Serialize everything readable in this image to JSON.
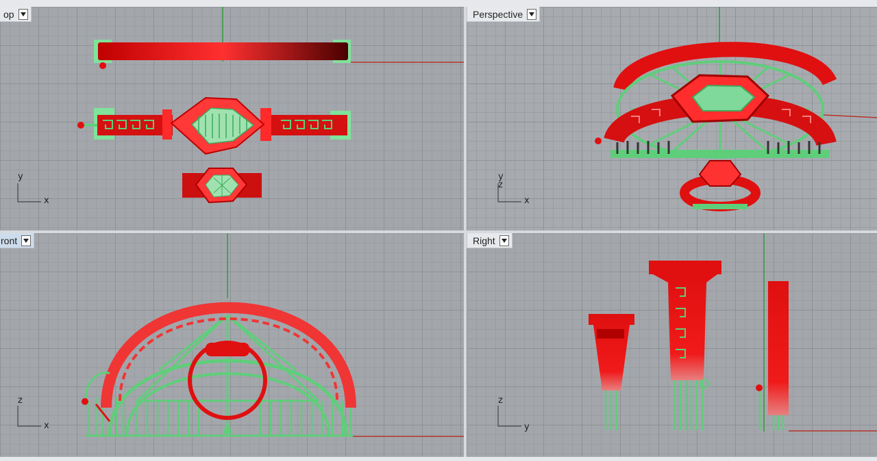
{
  "viewports": {
    "top": {
      "title": "op",
      "axes": {
        "vertical": "y",
        "horizontal": "x"
      }
    },
    "perspective": {
      "title": "Perspective",
      "axes": {
        "vertical": "z",
        "vertical2": "y",
        "horizontal": "x"
      }
    },
    "front": {
      "title": "ront",
      "axes": {
        "vertical": "z",
        "horizontal": "x"
      }
    },
    "right": {
      "title": "Right",
      "axes": {
        "vertical": "z",
        "horizontal": "y"
      }
    }
  },
  "colors": {
    "model": "#e01010",
    "support": "#5fce7a",
    "grid": "#a3a7ac",
    "x_axis": "#b5342c",
    "y_axis": "#2e9c3a"
  },
  "icons": [
    "chevron-down-icon"
  ]
}
